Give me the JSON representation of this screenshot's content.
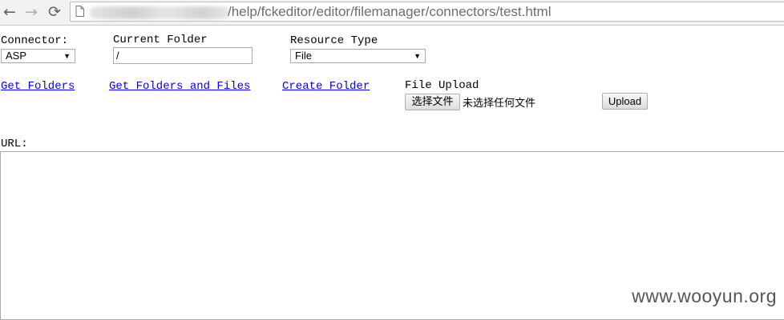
{
  "browser": {
    "back_icon": "←",
    "forward_icon": "→",
    "reload_icon": "⟳",
    "url_path": "/help/fckeditor/editor/filemanager/connectors/test.html"
  },
  "form": {
    "connector": {
      "label": "Connector:",
      "value": "ASP"
    },
    "current_folder": {
      "label": "Current Folder",
      "value": "/"
    },
    "resource_type": {
      "label": "Resource Type",
      "value": "File"
    },
    "links": {
      "get_folders": "Get Folders",
      "get_folders_files": "Get Folders and Files",
      "create_folder": "Create Folder"
    },
    "file_upload": {
      "label": "File Upload",
      "choose_button": "选择文件",
      "no_file_text": "未选择任何文件",
      "upload_button": "Upload"
    },
    "url_label": "URL:"
  },
  "watermark": "www.wooyun.org"
}
